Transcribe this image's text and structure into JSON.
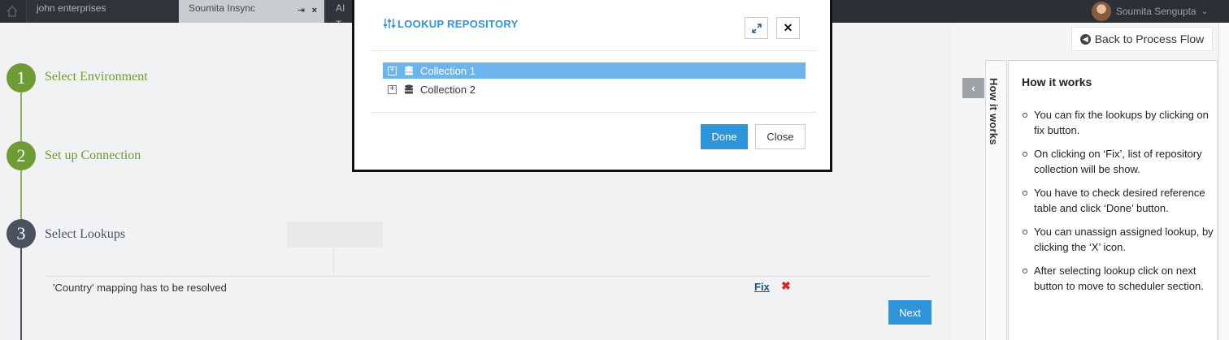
{
  "tabs": [
    {
      "label": "john enterprises"
    },
    {
      "label": "Soumita Insync"
    },
    {
      "label": "AI T"
    }
  ],
  "user": {
    "name": "Soumita Sengupta"
  },
  "steps": [
    {
      "number": "1",
      "label": "Select Environment",
      "color": "#6e9b33"
    },
    {
      "number": "2",
      "label": "Set up Connection",
      "color": "#6e9b33"
    },
    {
      "number": "3",
      "label": "Select Lookups",
      "color": "#4a5260"
    }
  ],
  "mapping": {
    "text": "'Country' mapping has to be resolved",
    "fix_label": "Fix"
  },
  "next_label": "Next",
  "back_label": "Back to Process Flow",
  "how": {
    "tab_label": "How it works",
    "title": "How it works",
    "items": [
      "You can fix the lookups by clicking on fix button.",
      "On clicking on ‘Fix’, list of repository collection will be show.",
      "You have to check desired reference table and click ‘Done’ button.",
      "You can unassign assigned lookup, by clicking the ‘X’ icon.",
      "After selecting lookup click on next button to move to scheduler section."
    ]
  },
  "modal": {
    "title": "LOOKUP REPOSITORY",
    "collections": [
      {
        "label": "Collection 1",
        "selected": true
      },
      {
        "label": "Collection 2",
        "selected": false
      }
    ],
    "done_label": "Done",
    "close_label": "Close"
  }
}
